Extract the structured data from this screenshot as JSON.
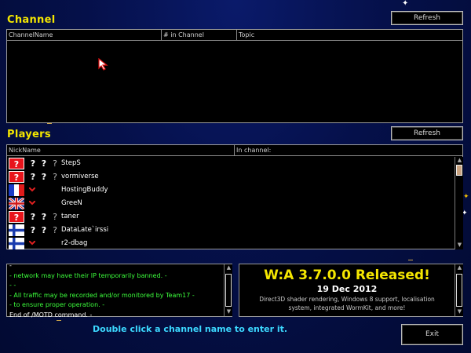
{
  "channel": {
    "title": "Channel",
    "refresh_label": "Refresh",
    "columns": [
      "ChannelName",
      "# in Channel",
      "Topic"
    ]
  },
  "players": {
    "title": "Players",
    "refresh_label": "Refresh",
    "columns": [
      "NickName",
      "In channel:"
    ],
    "rows": [
      {
        "flag": "unknown-flag",
        "ranks": "? ? ?",
        "name": "StepS"
      },
      {
        "flag": "unknown-flag",
        "ranks": "? ? ?",
        "name": "vormiverse"
      },
      {
        "flag": "france-flag",
        "ranks": "",
        "name": "HostingBuddy"
      },
      {
        "flag": "uk-flag",
        "ranks": "",
        "name": "GreeN"
      },
      {
        "flag": "unknown-flag",
        "ranks": "? ? ?",
        "name": "taner"
      },
      {
        "flag": "finland-flag",
        "ranks": "? ? ?",
        "name": "DataLate`irssi"
      },
      {
        "flag": "finland-flag",
        "ranks": "",
        "name": "r2-dbag"
      }
    ]
  },
  "motd": {
    "lines": [
      "-",
      "- network may have their IP temporarily banned. -",
      "-  -",
      "- All traffic may be recorded and/or monitored by Team17 -",
      "- to ensure proper operation. -",
      "End of /MOTD command. -"
    ]
  },
  "news": {
    "title": "W:A 3.7.0.0 Released!",
    "date": "19 Dec 2012",
    "body_line1": "Direct3D shader rendering, Windows 8 support, localisation",
    "body_line2": "system, integrated WormKit, and more!"
  },
  "footer": {
    "hint": "Double click a channel name to enter it.",
    "exit_label": "Exit"
  },
  "colors": {
    "title_yellow": "#f4e600",
    "hint_cyan": "#3cd8ff",
    "motd_green": "#3cff3c"
  }
}
